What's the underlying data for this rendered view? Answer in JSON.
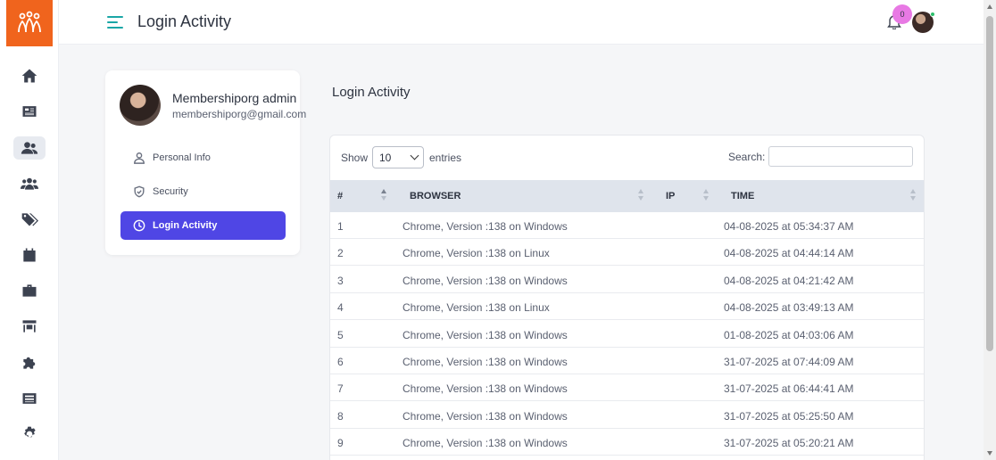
{
  "app": {
    "page_title": "Login Activity",
    "accent_color": "#4f46e5",
    "brand_color": "#f0641d"
  },
  "sidebar": {
    "items": [
      {
        "icon": "home-icon"
      },
      {
        "icon": "newspaper-icon"
      },
      {
        "icon": "users-icon",
        "active": true
      },
      {
        "icon": "group-icon"
      },
      {
        "icon": "tags-icon"
      },
      {
        "icon": "calendar-icon"
      },
      {
        "icon": "briefcase-icon"
      },
      {
        "icon": "store-icon"
      },
      {
        "icon": "puzzle-icon"
      },
      {
        "icon": "list-icon"
      },
      {
        "icon": "gear-icon"
      }
    ]
  },
  "header": {
    "notification_count": "0"
  },
  "profile": {
    "name": "Membershiporg admin",
    "email": "membershiporg@gmail.com",
    "menu": [
      {
        "label": "Personal Info",
        "icon": "user-icon"
      },
      {
        "label": "Security",
        "icon": "shield-icon"
      },
      {
        "label": "Login Activity",
        "icon": "clock-icon",
        "active": true
      }
    ]
  },
  "main": {
    "section_title": "Login Activity",
    "show_label": "Show",
    "entries_value": "10",
    "entries_label": "entries",
    "search_label": "Search:",
    "search_value": ""
  },
  "table": {
    "columns": [
      "#",
      "BROWSER",
      "IP",
      "TIME"
    ],
    "rows": [
      {
        "num": "1",
        "browser": "Chrome, Version :138 on Windows",
        "ip": "",
        "time": "04-08-2025 at 05:34:37 AM"
      },
      {
        "num": "2",
        "browser": "Chrome, Version :138 on Linux",
        "ip": "",
        "time": "04-08-2025 at 04:44:14 AM"
      },
      {
        "num": "3",
        "browser": "Chrome, Version :138 on Windows",
        "ip": "",
        "time": "04-08-2025 at 04:21:42 AM"
      },
      {
        "num": "4",
        "browser": "Chrome, Version :138 on Linux",
        "ip": "",
        "time": "04-08-2025 at 03:49:13 AM"
      },
      {
        "num": "5",
        "browser": "Chrome, Version :138 on Windows",
        "ip": "",
        "time": "01-08-2025 at 04:03:06 AM"
      },
      {
        "num": "6",
        "browser": "Chrome, Version :138 on Windows",
        "ip": "",
        "time": "31-07-2025 at 07:44:09 AM"
      },
      {
        "num": "7",
        "browser": "Chrome, Version :138 on Windows",
        "ip": "",
        "time": "31-07-2025 at 06:44:41 AM"
      },
      {
        "num": "8",
        "browser": "Chrome, Version :138 on Windows",
        "ip": "",
        "time": "31-07-2025 at 05:25:50 AM"
      },
      {
        "num": "9",
        "browser": "Chrome, Version :138 on Windows",
        "ip": "",
        "time": "31-07-2025 at 05:20:21 AM"
      }
    ]
  }
}
